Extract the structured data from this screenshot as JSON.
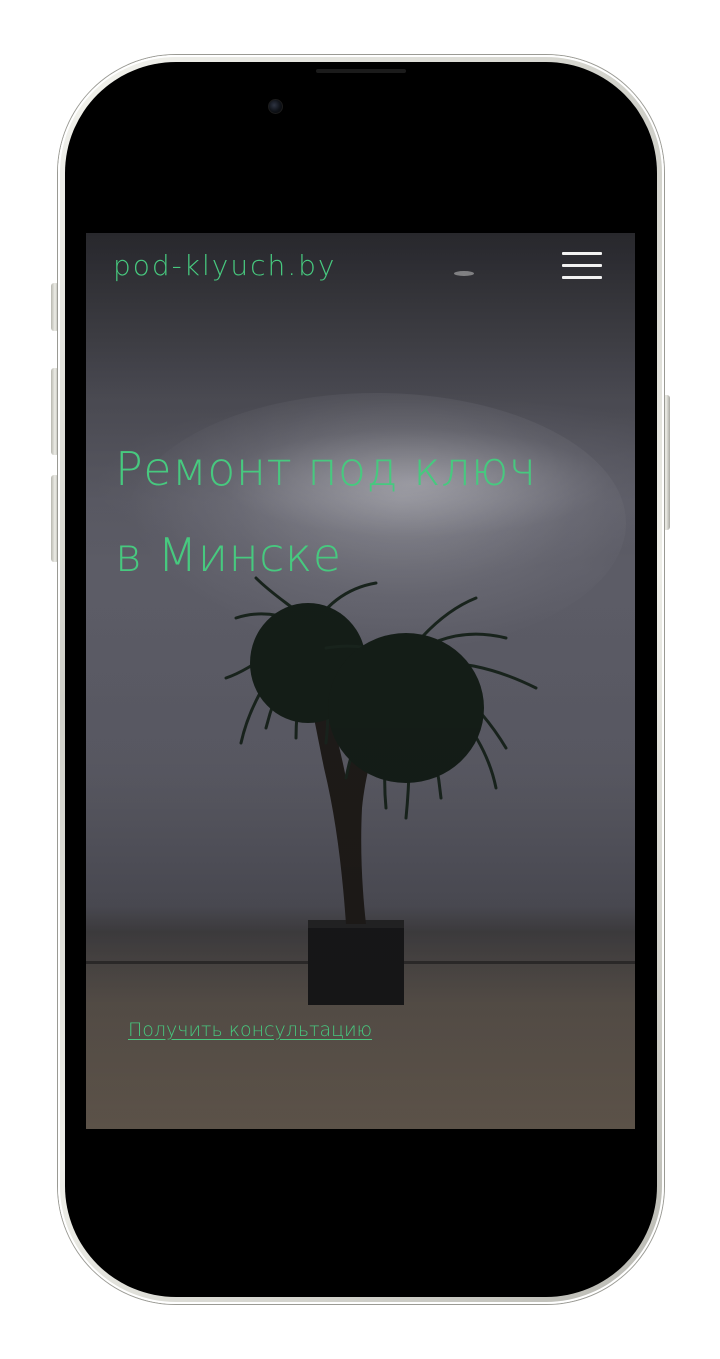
{
  "site": {
    "logo": "pod-klyuch.by",
    "menu_icon": "hamburger-menu-icon"
  },
  "hero": {
    "title_line1": "Ремонт под ключ",
    "title_line2": "в Минске",
    "cta_label": "Получить консультацию"
  },
  "colors": {
    "accent": "#47c97f",
    "menu_icon": "#f2f2f2",
    "phone_frame": "#e6e6e0",
    "screen_bezel": "#000000"
  }
}
